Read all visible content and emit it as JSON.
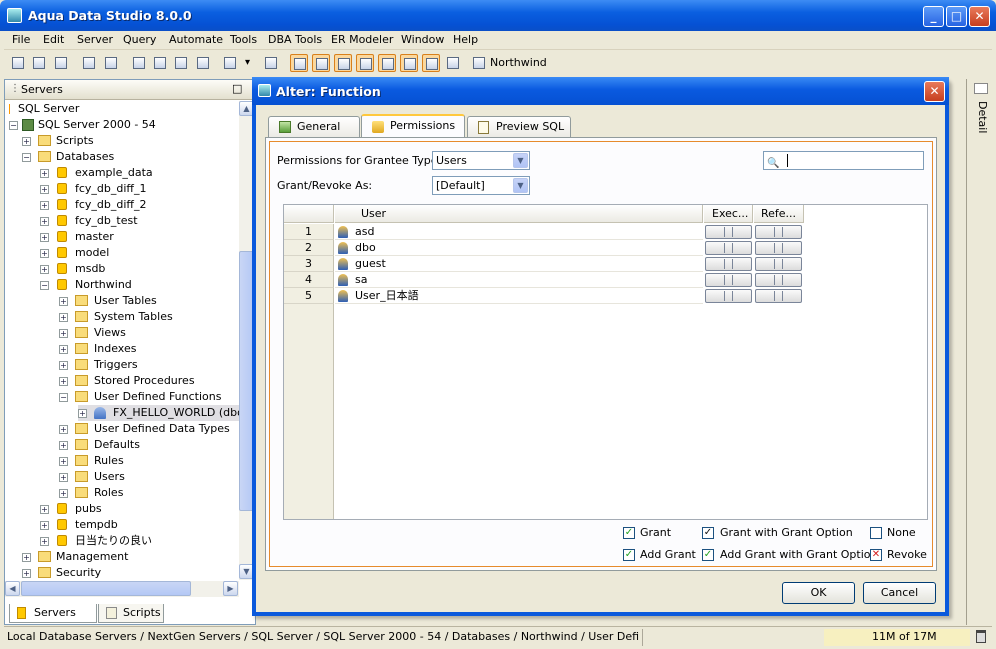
{
  "window": {
    "title": "Aqua Data Studio 8.0.0",
    "minimize": "_",
    "maximize": "□",
    "close": "✕"
  },
  "menu": [
    "File",
    "Edit",
    "Server",
    "Query",
    "Automate",
    "Tools",
    "DBA Tools",
    "ER Modeler",
    "Window",
    "Help"
  ],
  "toolbar": {
    "connection_label": "Northwind",
    "dropdown": "▾"
  },
  "servers_panel": {
    "title": "Servers",
    "restore": "□",
    "tree": [
      {
        "label": "SQL Server",
        "icon": "server-group-icon"
      },
      {
        "label": "SQL Server 2000 - 54",
        "icon": "server-icon"
      },
      {
        "label": "Scripts",
        "icon": "scripts-icon"
      },
      {
        "label": "Databases",
        "icon": "folder-icon"
      },
      {
        "label": "example_data",
        "icon": "database-icon"
      },
      {
        "label": "fcy_db_diff_1",
        "icon": "database-icon"
      },
      {
        "label": "fcy_db_diff_2",
        "icon": "database-icon"
      },
      {
        "label": "fcy_db_test",
        "icon": "database-icon"
      },
      {
        "label": "master",
        "icon": "database-icon"
      },
      {
        "label": "model",
        "icon": "database-icon"
      },
      {
        "label": "msdb",
        "icon": "database-icon"
      },
      {
        "label": "Northwind",
        "icon": "database-icon"
      },
      {
        "label": "User Tables",
        "icon": "folder-icon"
      },
      {
        "label": "System Tables",
        "icon": "folder-icon"
      },
      {
        "label": "Views",
        "icon": "folder-icon"
      },
      {
        "label": "Indexes",
        "icon": "folder-icon"
      },
      {
        "label": "Triggers",
        "icon": "folder-icon"
      },
      {
        "label": "Stored Procedures",
        "icon": "folder-icon"
      },
      {
        "label": "User Defined Functions",
        "icon": "folder-icon"
      },
      {
        "label": "FX_HELLO_WORLD (dbo)",
        "icon": "function-icon"
      },
      {
        "label": "User Defined Data Types",
        "icon": "folder-icon"
      },
      {
        "label": "Defaults",
        "icon": "folder-icon"
      },
      {
        "label": "Rules",
        "icon": "folder-icon"
      },
      {
        "label": "Users",
        "icon": "folder-icon"
      },
      {
        "label": "Roles",
        "icon": "folder-icon"
      },
      {
        "label": "pubs",
        "icon": "database-icon"
      },
      {
        "label": "tempdb",
        "icon": "database-icon"
      },
      {
        "label": "日当たりの良い",
        "icon": "database-icon"
      },
      {
        "label": "Management",
        "icon": "management-icon"
      },
      {
        "label": "Security",
        "icon": "security-icon"
      }
    ],
    "tabs": [
      "Servers",
      "Scripts"
    ]
  },
  "right_strip": {
    "label": "Detail"
  },
  "dialog": {
    "title": "Alter: Function",
    "close": "✕",
    "tabs": [
      "General",
      "Permissions",
      "Preview SQL"
    ],
    "grantee_type_label": "Permissions for Grantee Type:",
    "grantee_type_value": "Users",
    "grant_revoke_label": "Grant/Revoke As:",
    "grant_revoke_value": "[Default]",
    "search_placeholder": "",
    "grid": {
      "columns": [
        "User",
        "Exec...",
        "Refe..."
      ],
      "rows": [
        {
          "num": "1",
          "user": "asd"
        },
        {
          "num": "2",
          "user": "dbo"
        },
        {
          "num": "3",
          "user": "guest"
        },
        {
          "num": "4",
          "user": "sa"
        },
        {
          "num": "5",
          "user": "User_日本語"
        }
      ]
    },
    "legend": {
      "grant": "Grant",
      "grant_with_grant_option": "Grant with Grant Option",
      "none": "None",
      "add_grant": "Add Grant",
      "add_grant_with_grant_option": "Add Grant with Grant Option",
      "revoke": "Revoke"
    },
    "ok": "OK",
    "cancel": "Cancel"
  },
  "status": {
    "path": "Local Database Servers / NextGen Servers / SQL Server / SQL Server 2000 - 54 / Databases / Northwind / User Defined Function...",
    "memory": "11M of 17M"
  },
  "colors": {
    "xp_blue": "#0a5fe0",
    "tab_accent": "#e68b2c",
    "check_green": "#21a121",
    "revoke_red": "#d42020"
  }
}
